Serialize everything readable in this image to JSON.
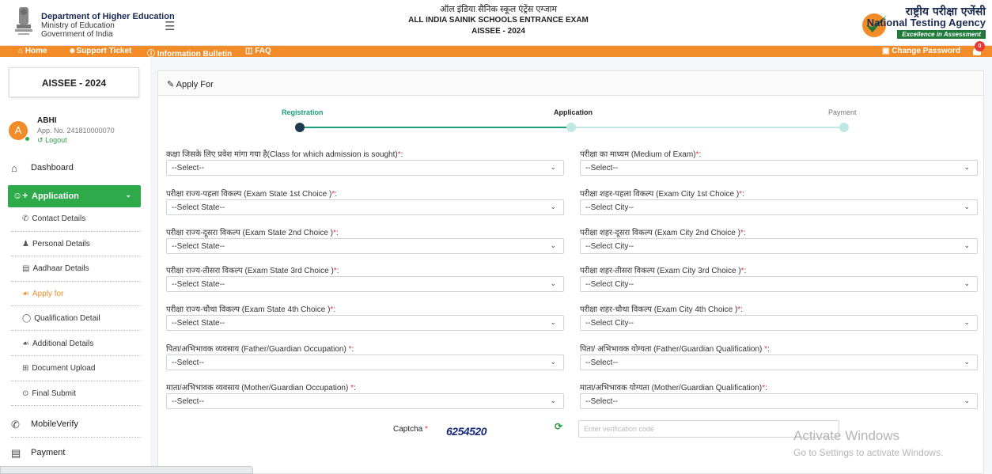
{
  "header": {
    "dept_title": "Department of Higher Education",
    "dept_line2": "Ministry of Education",
    "dept_line3": "Government of India",
    "title_hindi": "ऑल इंडिया सैनिक स्कूल एंट्रेंस एग्जाम",
    "title_english": "ALL INDIA SAINIK SCHOOLS ENTRANCE EXAM",
    "exam": "AISSEE - 2024",
    "nta_hindi": "राष्ट्रीय परीक्षा एजेंसी",
    "nta_english": "National Testing Agency",
    "nta_tagline": "Excellence in Assessment"
  },
  "topnav": {
    "home": "Home",
    "support": "Support Ticket",
    "bulletin": "Information Bulletin",
    "faq": "FAQ",
    "change_password": "Change Password",
    "notification_count": "0"
  },
  "sidebar": {
    "exam_box": "AISSEE - 2024",
    "user": {
      "initial": "A",
      "name": "ABHI",
      "app_no": "App. No. 241810000070",
      "logout": "Logout"
    },
    "dashboard": "Dashboard",
    "application": "Application",
    "sub_items": [
      {
        "label": "Contact Details",
        "icon": "phone-icon"
      },
      {
        "label": "Personal Details",
        "icon": "person-icon"
      },
      {
        "label": "Aadhaar Details",
        "icon": "id-card-icon"
      },
      {
        "label": "Apply for",
        "icon": "trophy-icon"
      },
      {
        "label": "Qualification Detail",
        "icon": "medal-icon"
      },
      {
        "label": "Additional Details",
        "icon": "trophy-icon"
      },
      {
        "label": "Document Upload",
        "icon": "upload-icon"
      },
      {
        "label": "Final Submit",
        "icon": "check-circle-icon"
      }
    ],
    "mobile_verify": "MobileVerify",
    "payment": "Payment"
  },
  "panel": {
    "title": "Apply For",
    "steps": [
      "Registration",
      "Application",
      "Payment"
    ],
    "fields": [
      {
        "label": "कक्षा जिसके लिए प्रवेश मांगा गया है(Class for which admission is sought)",
        "value": "--Select--"
      },
      {
        "label": "परीक्षा का माध्यम (Medium of Exam)",
        "value": "--Select--"
      },
      {
        "label": "परीक्षा राज्य-पहला विकल्प (Exam State 1st Choice )",
        "value": "--Select State--"
      },
      {
        "label": "परीक्षा शहर-पहला विकल्प (Exam City 1st Choice )",
        "value": "--Select City--"
      },
      {
        "label": "परीक्षा राज्य-दूसरा विकल्प (Exam State 2nd Choice )",
        "value": "--Select State--"
      },
      {
        "label": "परीक्षा शहर-दूसरा विकल्प (Exam City 2nd Choice )",
        "value": "--Select City--"
      },
      {
        "label": "परीक्षा राज्य-तीसरा विकल्प (Exam State 3rd Choice )",
        "value": "--Select State--"
      },
      {
        "label": "परीक्षा शहर-तीसरा विकल्प (Exam City 3rd Choice )",
        "value": "--Select City--"
      },
      {
        "label": "परीक्षा राज्य-चौथा विकल्प (Exam State 4th Choice )",
        "value": "--Select State--"
      },
      {
        "label": "परीक्षा शहर-चौथा विकल्प (Exam City 4th Choice )",
        "value": "--Select City--"
      },
      {
        "label": "पिता/अभिभावक व्यवसाय (Father/Guardian Occupation) ",
        "value": "--Select--"
      },
      {
        "label": "पिता/ अभिभावक योग्यता (Father/Guardian Qualification) ",
        "value": "--Select--"
      },
      {
        "label": "माता/अभिभावक व्यवसाय (Mother/Guardian Occupation) ",
        "value": "--Select--"
      },
      {
        "label": "माता/अभिभावक योग्यता (Mother/Guardian Qualification)",
        "value": "--Select--"
      }
    ],
    "captcha_label": "Captcha",
    "captcha_code": "6254520",
    "captcha_placeholder": "Enter verification code"
  },
  "watermark": {
    "line1": "Activate Windows",
    "line2": "Go to Settings to activate Windows."
  },
  "colors": {
    "accent_orange": "#f28c28",
    "accent_green": "#2eaa4a",
    "step_teal": "#1d9e7a",
    "step_pending": "#bfe8e3"
  }
}
